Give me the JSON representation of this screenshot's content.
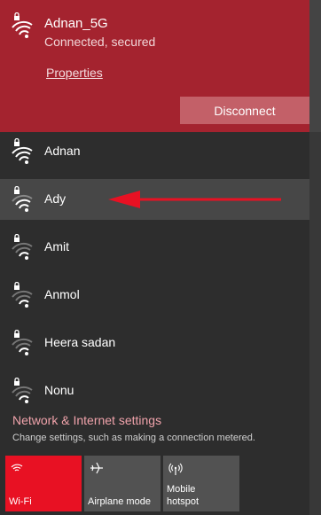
{
  "connected_network": {
    "name": "Adnan_5G",
    "status": "Connected, secured",
    "properties_label": "Properties",
    "disconnect_label": "Disconnect"
  },
  "networks": [
    {
      "name": "Adnan"
    },
    {
      "name": "Ady"
    },
    {
      "name": "Amit"
    },
    {
      "name": "Anmol"
    },
    {
      "name": "Heera sadan"
    },
    {
      "name": "Nonu"
    }
  ],
  "settings": {
    "title": "Network & Internet settings",
    "subtitle": "Change settings, such as making a connection metered."
  },
  "quick_actions": {
    "wifi": {
      "label": "Wi-Fi",
      "icon": "wifi-icon"
    },
    "airplane": {
      "label": "Airplane mode",
      "icon": "airplane-icon"
    },
    "hotspot": {
      "label_line1": "Mobile",
      "label_line2": "hotspot",
      "icon": "hotspot-icon"
    }
  },
  "colors": {
    "connected_bg": "#a4232f",
    "accent": "#e81123",
    "flyout_bg": "#2d2d2d",
    "arrow": "#e81123"
  }
}
